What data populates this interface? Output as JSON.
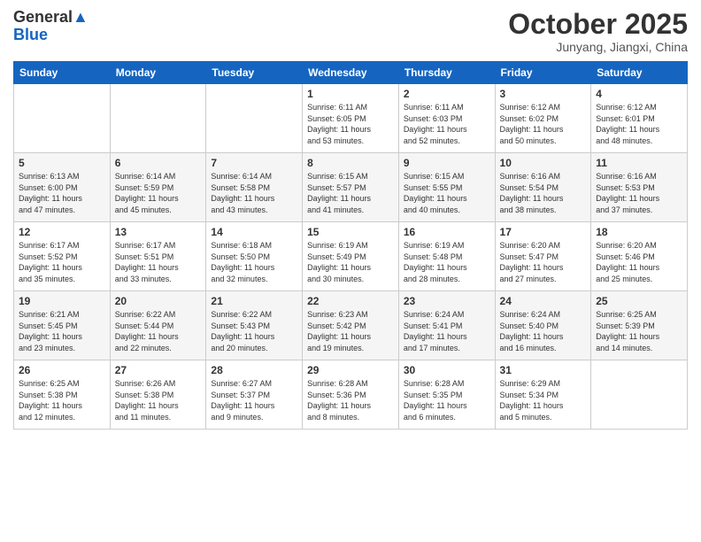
{
  "header": {
    "logo_general": "General",
    "logo_blue": "Blue",
    "month_title": "October 2025",
    "location": "Junyang, Jiangxi, China"
  },
  "days_of_week": [
    "Sunday",
    "Monday",
    "Tuesday",
    "Wednesday",
    "Thursday",
    "Friday",
    "Saturday"
  ],
  "weeks": [
    [
      {
        "day": "",
        "info": ""
      },
      {
        "day": "",
        "info": ""
      },
      {
        "day": "",
        "info": ""
      },
      {
        "day": "1",
        "info": "Sunrise: 6:11 AM\nSunset: 6:05 PM\nDaylight: 11 hours\nand 53 minutes."
      },
      {
        "day": "2",
        "info": "Sunrise: 6:11 AM\nSunset: 6:03 PM\nDaylight: 11 hours\nand 52 minutes."
      },
      {
        "day": "3",
        "info": "Sunrise: 6:12 AM\nSunset: 6:02 PM\nDaylight: 11 hours\nand 50 minutes."
      },
      {
        "day": "4",
        "info": "Sunrise: 6:12 AM\nSunset: 6:01 PM\nDaylight: 11 hours\nand 48 minutes."
      }
    ],
    [
      {
        "day": "5",
        "info": "Sunrise: 6:13 AM\nSunset: 6:00 PM\nDaylight: 11 hours\nand 47 minutes."
      },
      {
        "day": "6",
        "info": "Sunrise: 6:14 AM\nSunset: 5:59 PM\nDaylight: 11 hours\nand 45 minutes."
      },
      {
        "day": "7",
        "info": "Sunrise: 6:14 AM\nSunset: 5:58 PM\nDaylight: 11 hours\nand 43 minutes."
      },
      {
        "day": "8",
        "info": "Sunrise: 6:15 AM\nSunset: 5:57 PM\nDaylight: 11 hours\nand 41 minutes."
      },
      {
        "day": "9",
        "info": "Sunrise: 6:15 AM\nSunset: 5:55 PM\nDaylight: 11 hours\nand 40 minutes."
      },
      {
        "day": "10",
        "info": "Sunrise: 6:16 AM\nSunset: 5:54 PM\nDaylight: 11 hours\nand 38 minutes."
      },
      {
        "day": "11",
        "info": "Sunrise: 6:16 AM\nSunset: 5:53 PM\nDaylight: 11 hours\nand 37 minutes."
      }
    ],
    [
      {
        "day": "12",
        "info": "Sunrise: 6:17 AM\nSunset: 5:52 PM\nDaylight: 11 hours\nand 35 minutes."
      },
      {
        "day": "13",
        "info": "Sunrise: 6:17 AM\nSunset: 5:51 PM\nDaylight: 11 hours\nand 33 minutes."
      },
      {
        "day": "14",
        "info": "Sunrise: 6:18 AM\nSunset: 5:50 PM\nDaylight: 11 hours\nand 32 minutes."
      },
      {
        "day": "15",
        "info": "Sunrise: 6:19 AM\nSunset: 5:49 PM\nDaylight: 11 hours\nand 30 minutes."
      },
      {
        "day": "16",
        "info": "Sunrise: 6:19 AM\nSunset: 5:48 PM\nDaylight: 11 hours\nand 28 minutes."
      },
      {
        "day": "17",
        "info": "Sunrise: 6:20 AM\nSunset: 5:47 PM\nDaylight: 11 hours\nand 27 minutes."
      },
      {
        "day": "18",
        "info": "Sunrise: 6:20 AM\nSunset: 5:46 PM\nDaylight: 11 hours\nand 25 minutes."
      }
    ],
    [
      {
        "day": "19",
        "info": "Sunrise: 6:21 AM\nSunset: 5:45 PM\nDaylight: 11 hours\nand 23 minutes."
      },
      {
        "day": "20",
        "info": "Sunrise: 6:22 AM\nSunset: 5:44 PM\nDaylight: 11 hours\nand 22 minutes."
      },
      {
        "day": "21",
        "info": "Sunrise: 6:22 AM\nSunset: 5:43 PM\nDaylight: 11 hours\nand 20 minutes."
      },
      {
        "day": "22",
        "info": "Sunrise: 6:23 AM\nSunset: 5:42 PM\nDaylight: 11 hours\nand 19 minutes."
      },
      {
        "day": "23",
        "info": "Sunrise: 6:24 AM\nSunset: 5:41 PM\nDaylight: 11 hours\nand 17 minutes."
      },
      {
        "day": "24",
        "info": "Sunrise: 6:24 AM\nSunset: 5:40 PM\nDaylight: 11 hours\nand 16 minutes."
      },
      {
        "day": "25",
        "info": "Sunrise: 6:25 AM\nSunset: 5:39 PM\nDaylight: 11 hours\nand 14 minutes."
      }
    ],
    [
      {
        "day": "26",
        "info": "Sunrise: 6:25 AM\nSunset: 5:38 PM\nDaylight: 11 hours\nand 12 minutes."
      },
      {
        "day": "27",
        "info": "Sunrise: 6:26 AM\nSunset: 5:38 PM\nDaylight: 11 hours\nand 11 minutes."
      },
      {
        "day": "28",
        "info": "Sunrise: 6:27 AM\nSunset: 5:37 PM\nDaylight: 11 hours\nand 9 minutes."
      },
      {
        "day": "29",
        "info": "Sunrise: 6:28 AM\nSunset: 5:36 PM\nDaylight: 11 hours\nand 8 minutes."
      },
      {
        "day": "30",
        "info": "Sunrise: 6:28 AM\nSunset: 5:35 PM\nDaylight: 11 hours\nand 6 minutes."
      },
      {
        "day": "31",
        "info": "Sunrise: 6:29 AM\nSunset: 5:34 PM\nDaylight: 11 hours\nand 5 minutes."
      },
      {
        "day": "",
        "info": ""
      }
    ]
  ]
}
